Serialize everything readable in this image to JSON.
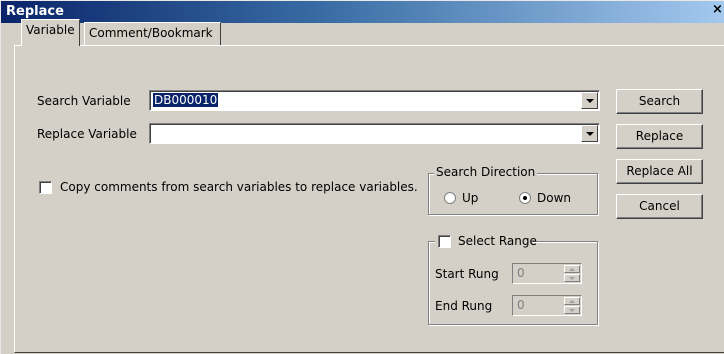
{
  "window": {
    "title": "Replace",
    "close_glyph": "×"
  },
  "tabs": [
    {
      "label": "Variable",
      "active": true
    },
    {
      "label": "Comment/Bookmark",
      "active": false
    }
  ],
  "form": {
    "search_variable_label": "Search Variable",
    "search_variable_value": "DB000010",
    "replace_variable_label": "Replace Variable",
    "replace_variable_value": "",
    "copy_comments_label": "Copy comments from search variables to replace variables.",
    "copy_comments_checked": false
  },
  "search_direction": {
    "title": "Search Direction",
    "options": [
      {
        "label": "Up",
        "checked": false
      },
      {
        "label": "Down",
        "checked": true
      }
    ]
  },
  "select_range": {
    "title": "Select Range",
    "checked": false,
    "start_rung_label": "Start Rung",
    "start_rung_value": "0",
    "end_rung_label": "End Rung",
    "end_rung_value": "0"
  },
  "buttons": {
    "search": "Search",
    "replace": "Replace",
    "replace_all": "Replace All",
    "cancel": "Cancel"
  },
  "colors": {
    "title_bar": "#0a246a",
    "dialog_face": "#d4d0c8",
    "selection": "#0a246a"
  }
}
